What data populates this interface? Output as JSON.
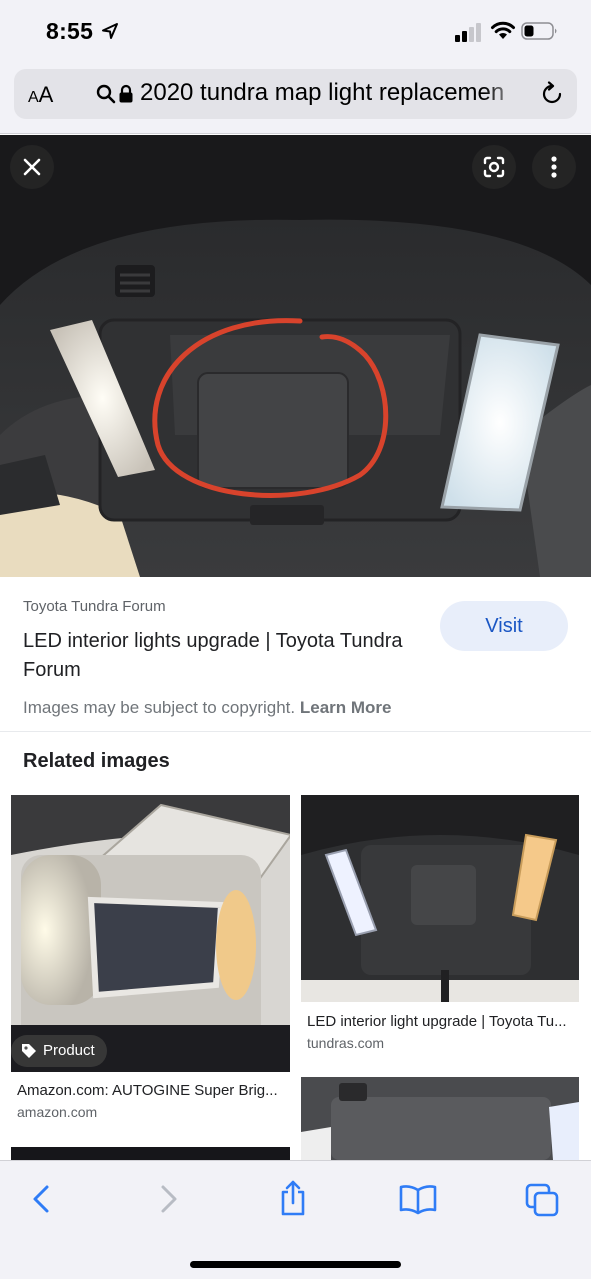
{
  "status_bar": {
    "time": "8:55",
    "icons": [
      "location-arrow-icon",
      "cellular-signal-icon",
      "wifi-icon",
      "battery-icon"
    ]
  },
  "address_bar": {
    "text_size_label_small": "A",
    "text_size_label_large": "A",
    "url": "2020 tundra map light replacemen"
  },
  "result": {
    "source": "Toyota Tundra Forum",
    "title": "LED interior lights upgrade | Toyota Tundra Forum",
    "visit_label": "Visit",
    "copyright_text": "Images may be subject to copyright.",
    "learn_more_label": "Learn More"
  },
  "related": {
    "heading": "Related images",
    "items": [
      {
        "caption": "Amazon.com: AUTOGINE Super Brig...",
        "domain": "amazon.com",
        "badge": "Product"
      },
      {
        "caption": "LED interior light upgrade | Toyota Tu...",
        "domain": "tundras.com"
      }
    ]
  },
  "colors": {
    "accent": "#1a56c4",
    "visit_bg": "#e8eefa",
    "ios_blue": "#2f7cf6",
    "circle_annotation": "#d8432c"
  }
}
